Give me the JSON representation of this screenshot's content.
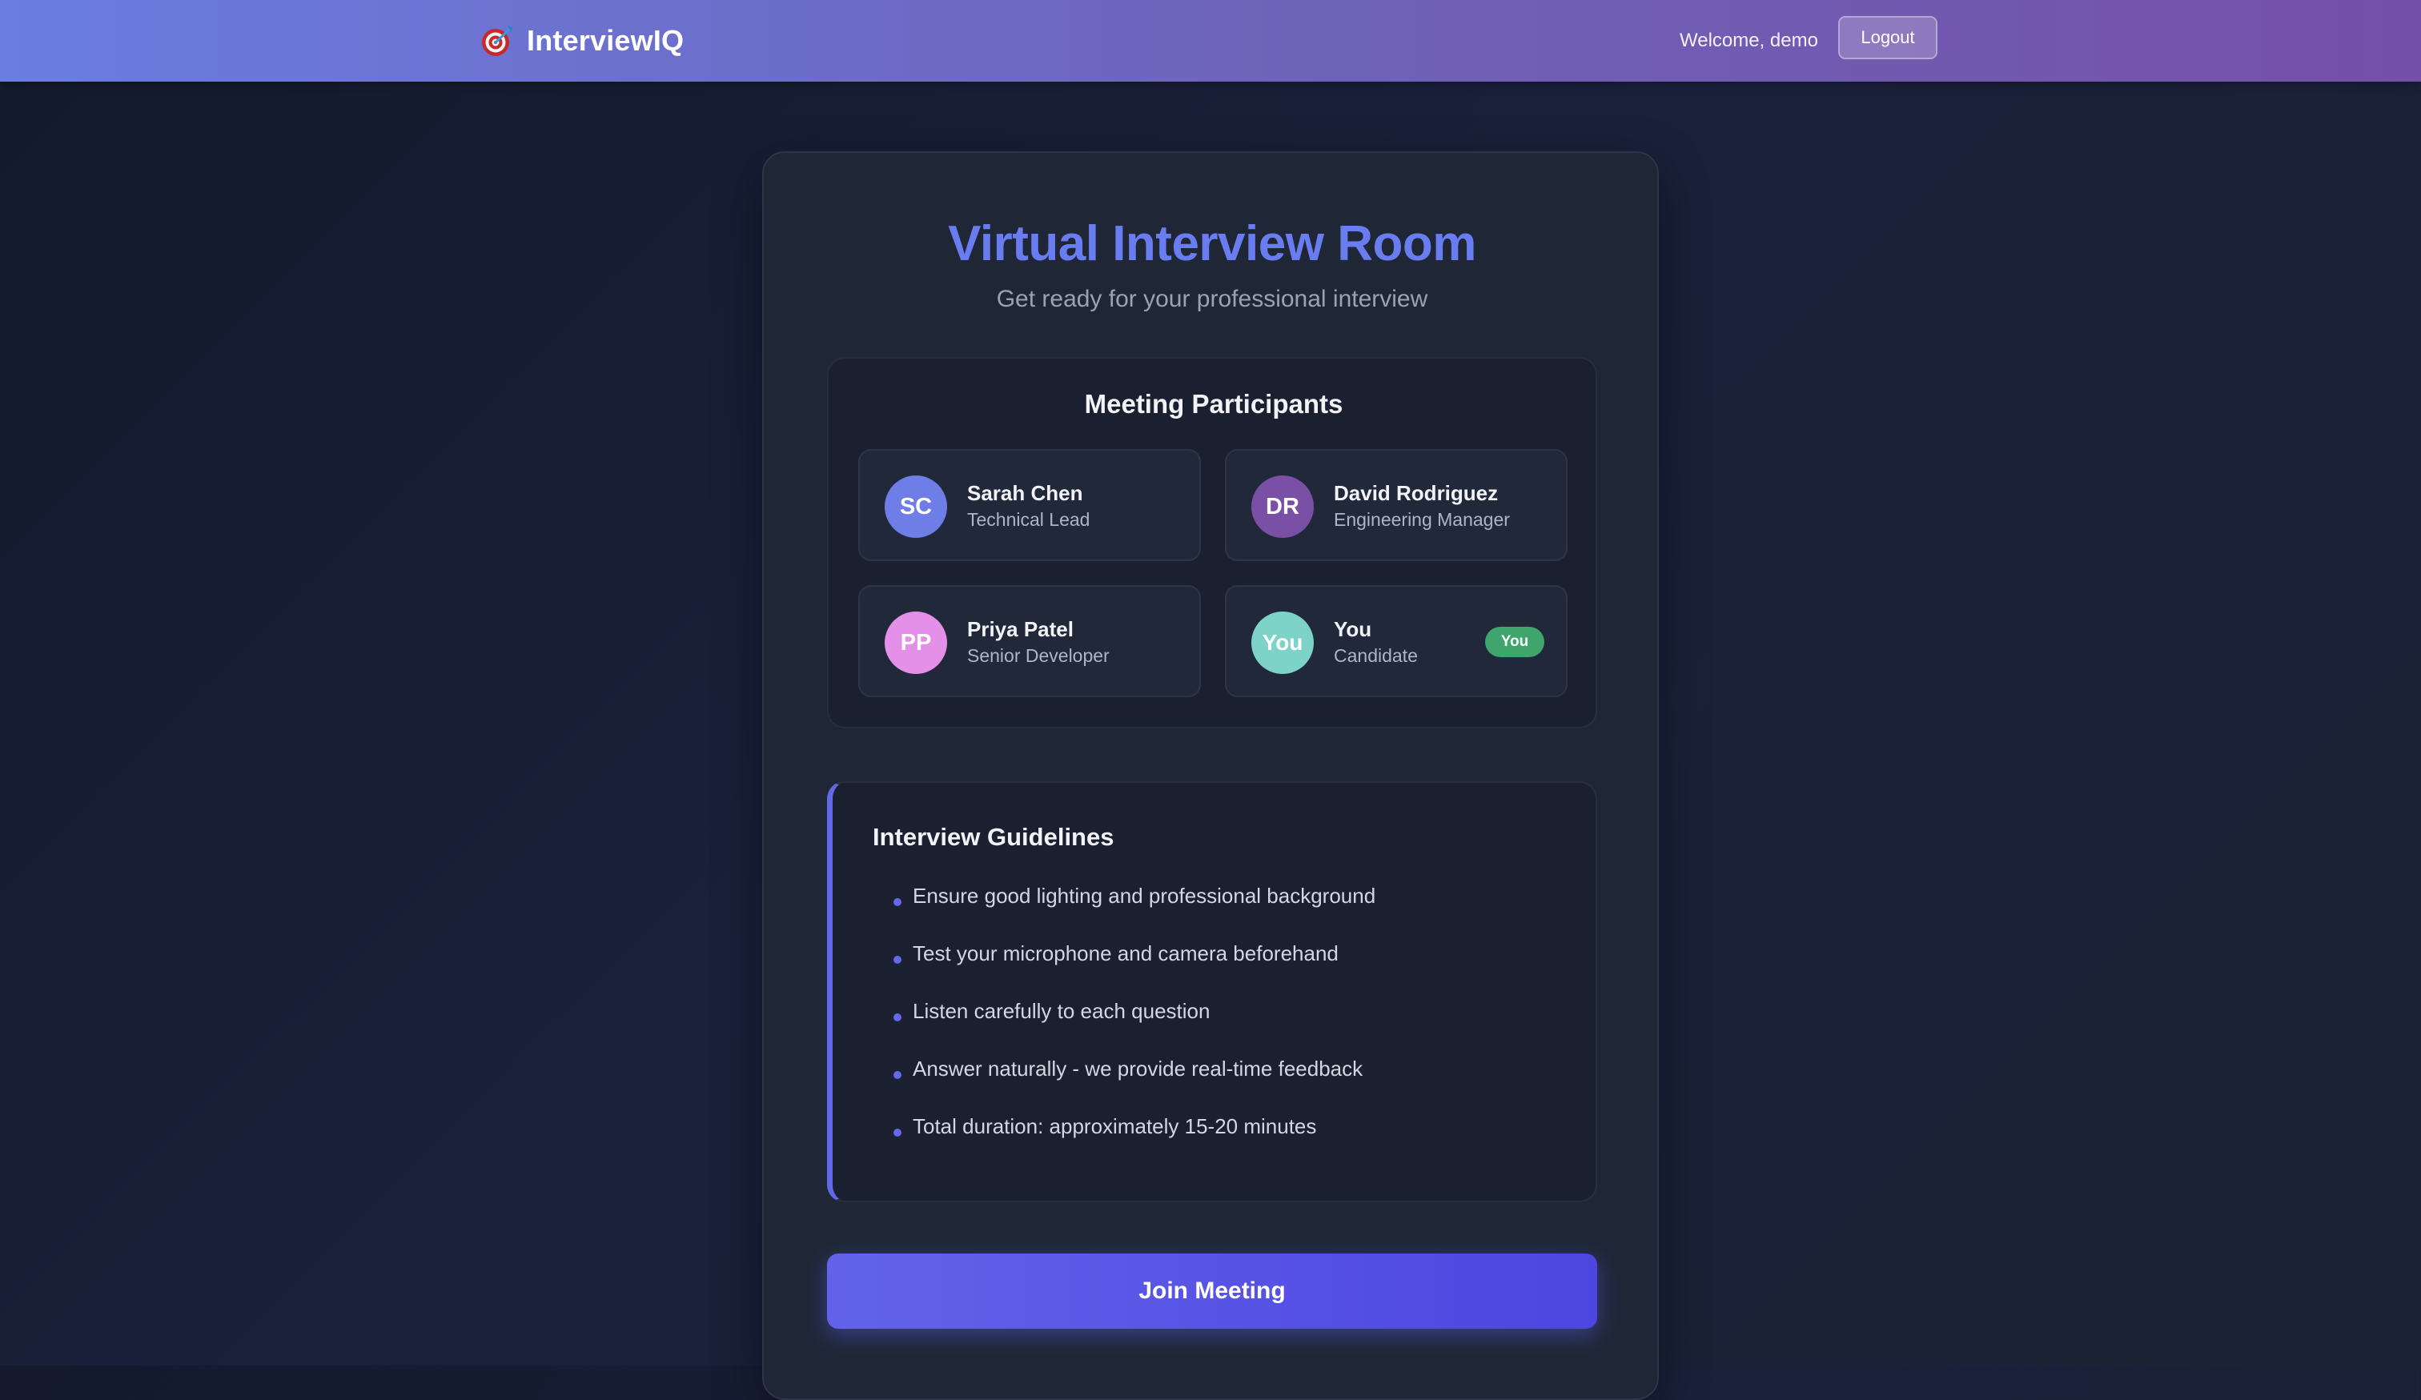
{
  "header": {
    "brand_name": "InterviewIQ",
    "brand_icon": "target-dart-icon",
    "welcome_text": "Welcome, demo",
    "logout_label": "Logout"
  },
  "room": {
    "title": "Virtual Interview Room",
    "subtitle": "Get ready for your professional interview"
  },
  "participants": {
    "title": "Meeting Participants",
    "items": [
      {
        "initials": "SC",
        "name": "Sarah Chen",
        "role": "Technical Lead",
        "avatar_color": "#6f7ee6"
      },
      {
        "initials": "DR",
        "name": "David Rodriguez",
        "role": "Engineering Manager",
        "avatar_color": "#7a4fa6"
      },
      {
        "initials": "PP",
        "name": "Priya Patel",
        "role": "Senior Developer",
        "avatar_color": "#e48fe8"
      },
      {
        "initials": "You",
        "name": "You",
        "role": "Candidate",
        "avatar_color": "#7dd3c8",
        "badge": "You",
        "badge_color": "#3fa56c"
      }
    ]
  },
  "guidelines": {
    "title": "Interview Guidelines",
    "items": [
      "Ensure good lighting and professional background",
      "Test your microphone and camera beforehand",
      "Listen carefully to each question",
      "Answer naturally - we provide real-time feedback",
      "Total duration: approximately 15-20 minutes"
    ]
  },
  "actions": {
    "join_label": "Join Meeting"
  },
  "colors": {
    "accent": "#6a7df0",
    "header_gradient_start": "#6a7de0",
    "header_gradient_end": "#7550a8",
    "join_button": "#5a55e6"
  }
}
